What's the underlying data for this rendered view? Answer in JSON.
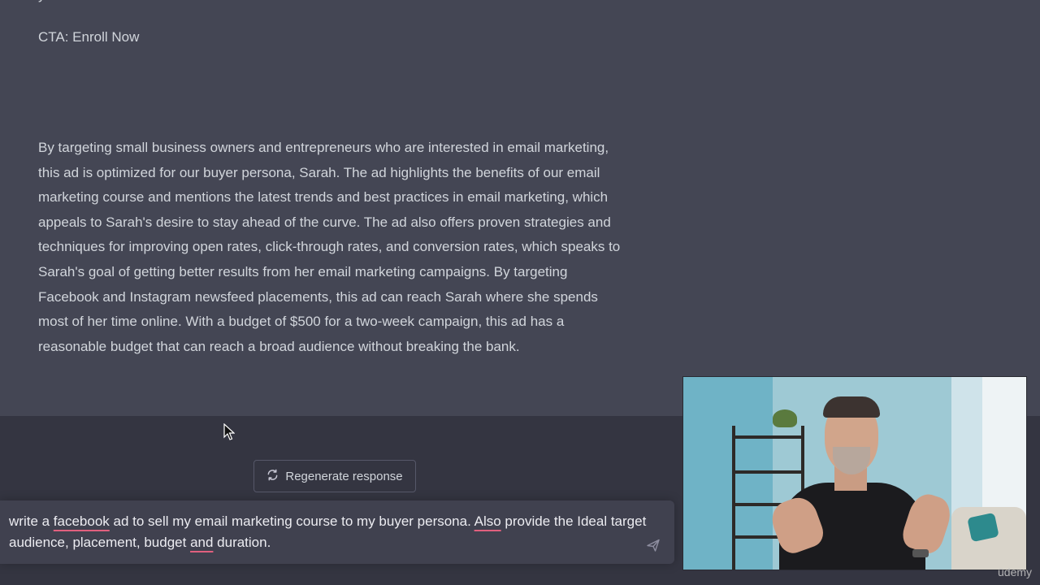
{
  "conversation": {
    "cta_line": "CTA: Enroll Now",
    "analysis_paragraph": "By targeting small business owners and entrepreneurs who are interested in email marketing, this ad is optimized for our buyer persona, Sarah. The ad highlights the benefits of our email marketing course and mentions the latest trends and best practices in email marketing, which appeals to Sarah's desire to stay ahead of the curve. The ad also offers proven strategies and techniques for improving open rates, click-through rates, and conversion rates, which speaks to Sarah's goal of getting better results from her email marketing campaigns. By targeting Facebook and Instagram newsfeed placements, this ad can reach Sarah where she spends most of her time online. With a budget of $500 for a two-week campaign, this ad has a reasonable budget that can reach a broad audience without breaking the bank."
  },
  "composer": {
    "regenerate_label": "Regenerate response",
    "prompt_parts": {
      "p1": "write a ",
      "w1": "facebook",
      "p2": " ad to sell my email marketing course to my buyer persona. ",
      "w2": "Also",
      "p3": " provide the Ideal target audience, placement, budget ",
      "w3": "and",
      "p4": " duration."
    }
  },
  "icons": {
    "regenerate": "refresh-icon",
    "send": "send-icon",
    "cursor": "mouse-cursor-icon"
  },
  "overlay": {
    "watermark": "ūdemy"
  },
  "colors": {
    "transcript_bg": "#444654",
    "page_bg": "#343541",
    "composer_bg": "#40414f",
    "text": "#d1d5db",
    "spellcheck_underline": "#e0607e"
  }
}
